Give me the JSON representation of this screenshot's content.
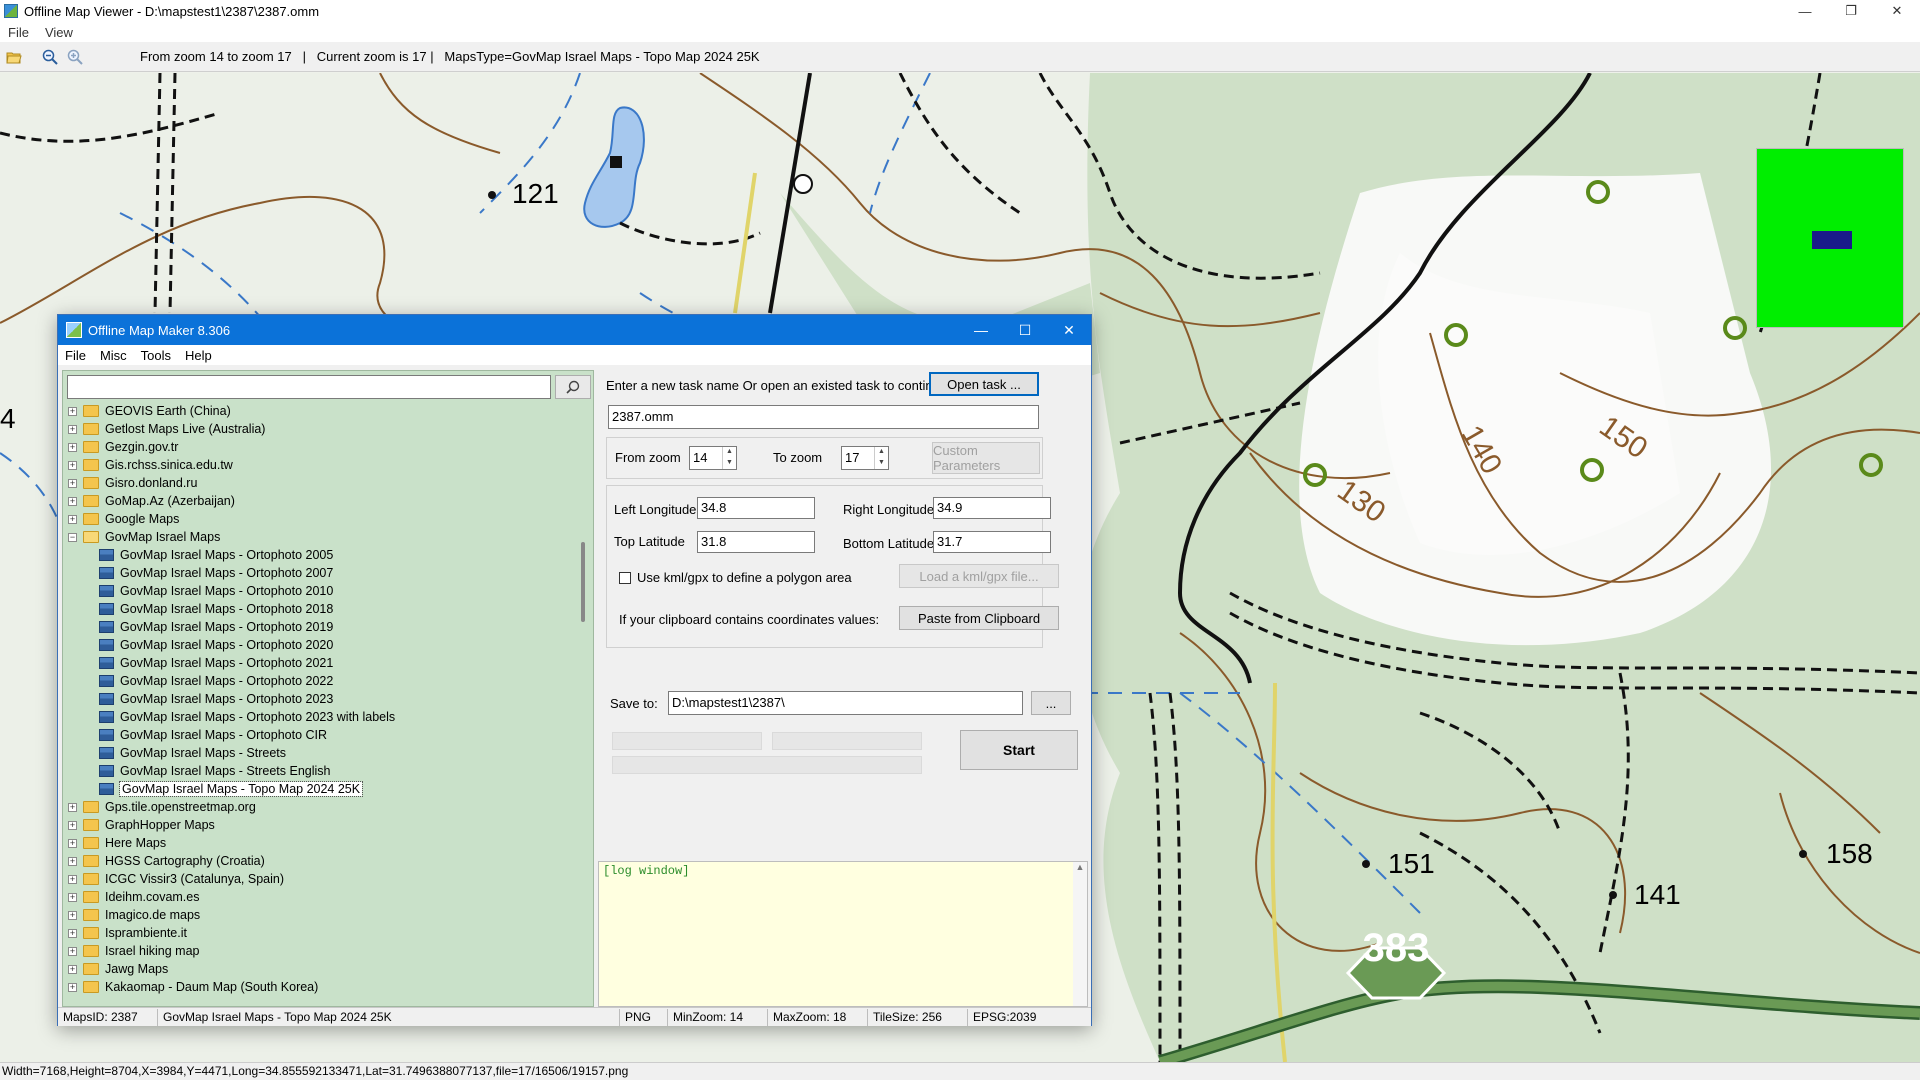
{
  "window": {
    "title": "Offline Map Viewer - D:\\mapstest1\\2387\\2387.omm",
    "controls": {
      "minimize": "—",
      "restore": "❐",
      "close": "✕"
    }
  },
  "menu": [
    "File",
    "View"
  ],
  "toolbar": {
    "status": "From zoom 14 to zoom 17   |   Current zoom is 17 |   MapsType=GovMap Israel Maps - Topo Map 2024 25K"
  },
  "map": {
    "labels": {
      "p121": "121",
      "p151": "151",
      "p141": "141",
      "p158": "158",
      "c130": "130",
      "c140": "140",
      "c150": "150",
      "r383": "383",
      "edge4": "4"
    },
    "colors": {
      "background": "#ecf0e8",
      "forest": "#cfe0c7",
      "contour": "#8a5a2b",
      "road": "#111111",
      "stream": "#3a78c8",
      "highway": "#6a9a55",
      "minimap": "#00ee00"
    }
  },
  "statusbar": {
    "text": "Width=7168,Height=8704,X=3984,Y=4471,Long=34.855592133471,Lat=31.7496388077137,file=17/16506/19157.png"
  },
  "dialog": {
    "title": "Offline Map Maker 8.306",
    "controls": {
      "minimize": "—",
      "maximize": "☐",
      "close": "✕"
    },
    "menu": [
      "File",
      "Misc",
      "Tools",
      "Help"
    ],
    "search": {
      "value": "",
      "placeholder": ""
    },
    "tree": [
      {
        "label": "GEOVIS Earth (China)",
        "type": "folder"
      },
      {
        "label": "Getlost Maps Live (Australia)",
        "type": "folder"
      },
      {
        "label": "Gezgin.gov.tr",
        "type": "folder"
      },
      {
        "label": "Gis.rchss.sinica.edu.tw",
        "type": "folder"
      },
      {
        "label": "Gisro.donland.ru",
        "type": "folder"
      },
      {
        "label": "GoMap.Az (Azerbaijan)",
        "type": "folder"
      },
      {
        "label": "Google Maps",
        "type": "folder"
      },
      {
        "label": "GovMap Israel Maps",
        "type": "folder-open"
      },
      {
        "label": "GovMap Israel Maps - Ortophoto 2005",
        "type": "child"
      },
      {
        "label": "GovMap Israel Maps - Ortophoto 2007",
        "type": "child"
      },
      {
        "label": "GovMap Israel Maps - Ortophoto 2010",
        "type": "child"
      },
      {
        "label": "GovMap Israel Maps - Ortophoto 2018",
        "type": "child"
      },
      {
        "label": "GovMap Israel Maps - Ortophoto 2019",
        "type": "child"
      },
      {
        "label": "GovMap Israel Maps - Ortophoto 2020",
        "type": "child"
      },
      {
        "label": "GovMap Israel Maps - Ortophoto 2021",
        "type": "child"
      },
      {
        "label": "GovMap Israel Maps - Ortophoto 2022",
        "type": "child"
      },
      {
        "label": "GovMap Israel Maps - Ortophoto 2023",
        "type": "child"
      },
      {
        "label": "GovMap Israel Maps - Ortophoto 2023 with labels",
        "type": "child"
      },
      {
        "label": "GovMap Israel Maps - Ortophoto CIR",
        "type": "child"
      },
      {
        "label": "GovMap Israel Maps - Streets",
        "type": "child"
      },
      {
        "label": "GovMap Israel Maps - Streets English",
        "type": "child"
      },
      {
        "label": "GovMap Israel Maps - Topo Map 2024 25K",
        "type": "child",
        "selected": true
      },
      {
        "label": "Gps.tile.openstreetmap.org",
        "type": "folder"
      },
      {
        "label": "GraphHopper Maps",
        "type": "folder"
      },
      {
        "label": "Here Maps",
        "type": "folder"
      },
      {
        "label": "HGSS Cartography (Croatia)",
        "type": "folder"
      },
      {
        "label": "ICGC Vissir3 (Catalunya, Spain)",
        "type": "folder"
      },
      {
        "label": "Ideihm.covam.es",
        "type": "folder"
      },
      {
        "label": "Imagico.de maps",
        "type": "folder"
      },
      {
        "label": "Isprambiente.it",
        "type": "folder"
      },
      {
        "label": "Israel hiking map",
        "type": "folder"
      },
      {
        "label": "Jawg Maps",
        "type": "folder"
      },
      {
        "label": "Kakaomap - Daum Map (South Korea)",
        "type": "folder"
      }
    ],
    "task": {
      "prompt": "Enter a new task name Or open an existed task to continue:",
      "open_button": "Open task ...",
      "name_value": "2387.omm"
    },
    "zoom": {
      "from_label": "From zoom",
      "from_value": "14",
      "to_label": "To zoom",
      "to_value": "17",
      "custom_button": "Custom Parameters"
    },
    "coords": {
      "left_lon_label": "Left Longitude",
      "left_lon": "34.8",
      "right_lon_label": "Right Longitude",
      "right_lon": "34.9",
      "top_lat_label": "Top Latitude",
      "top_lat": "31.8",
      "bottom_lat_label": "Bottom Latitude",
      "bottom_lat": "31.7",
      "kml_checkbox_label": "Use kml/gpx to define a polygon area",
      "kml_checked": false,
      "load_kml_button": "Load a kml/gpx file...",
      "clipboard_label": "If your clipboard contains coordinates values:",
      "paste_button": "Paste from Clipboard"
    },
    "save": {
      "label": "Save to:",
      "path": "D:\\mapstest1\\2387\\",
      "browse_button": "..."
    },
    "progress": [
      0,
      0,
      0
    ],
    "start_button": "Start",
    "log_text": "[log window]",
    "status": {
      "maps_id": "MapsID: 2387",
      "maps_name": "GovMap Israel Maps - Topo Map 2024 25K",
      "format": "PNG",
      "min_zoom": "MinZoom: 14",
      "max_zoom": "MaxZoom: 18",
      "tile_size": "TileSize: 256",
      "epsg": "EPSG:2039"
    }
  }
}
